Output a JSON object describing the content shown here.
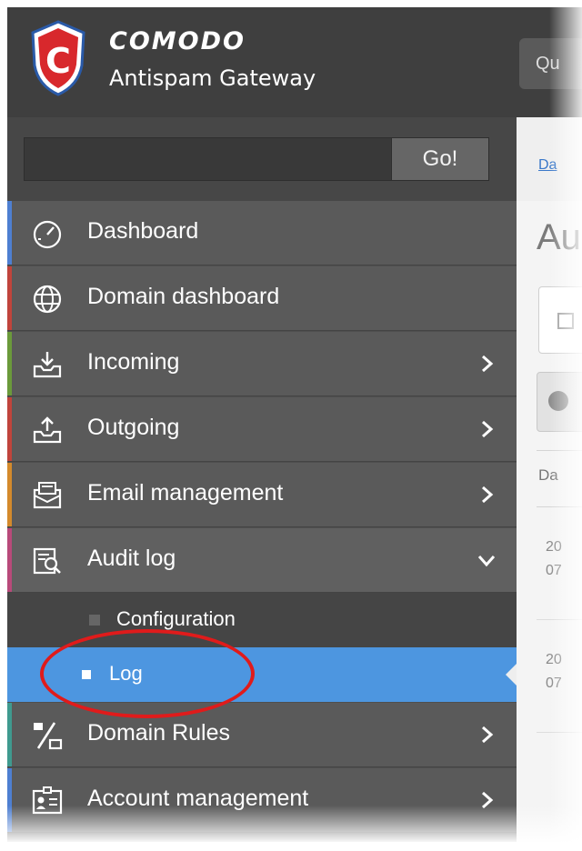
{
  "header": {
    "brand": "COMODO",
    "product": "Antispam Gateway",
    "quick_button_label": "Qu"
  },
  "search": {
    "value": "",
    "go_label": "Go!"
  },
  "sidebar": {
    "items": [
      {
        "label": "Dashboard",
        "icon": "dashboard-gauge-icon",
        "strip": "#4e7fd1",
        "has_chevron": false
      },
      {
        "label": "Domain dashboard",
        "icon": "globe-icon",
        "strip": "#c0443c",
        "has_chevron": false
      },
      {
        "label": "Incoming",
        "icon": "inbox-download-icon",
        "strip": "#6b9a3b",
        "has_chevron": true
      },
      {
        "label": "Outgoing",
        "icon": "outbox-upload-icon",
        "strip": "#c0443c",
        "has_chevron": true
      },
      {
        "label": "Email management",
        "icon": "envelope-icon",
        "strip": "#d48a2c",
        "has_chevron": true
      },
      {
        "label": "Audit log",
        "icon": "audit-search-icon",
        "strip": "#b84a7a",
        "has_chevron": true,
        "expanded": true
      },
      {
        "label": "Domain Rules",
        "icon": "percent-rules-icon",
        "strip": "#3f9a8f",
        "has_chevron": true
      },
      {
        "label": "Account management",
        "icon": "account-card-icon",
        "strip": "#4e7fd1",
        "has_chevron": true
      }
    ],
    "audit_submenu": [
      {
        "label": "Configuration",
        "active": false
      },
      {
        "label": "Log",
        "active": true
      }
    ]
  },
  "content": {
    "breadcrumb": "Da",
    "title": "Au",
    "column_header": "Da",
    "rows": [
      {
        "line1": "20",
        "line2": "07"
      },
      {
        "line1": "20",
        "line2": "07"
      }
    ]
  },
  "annotation": {
    "highlight_color": "#e01b1b",
    "highlight_target": "Log"
  }
}
